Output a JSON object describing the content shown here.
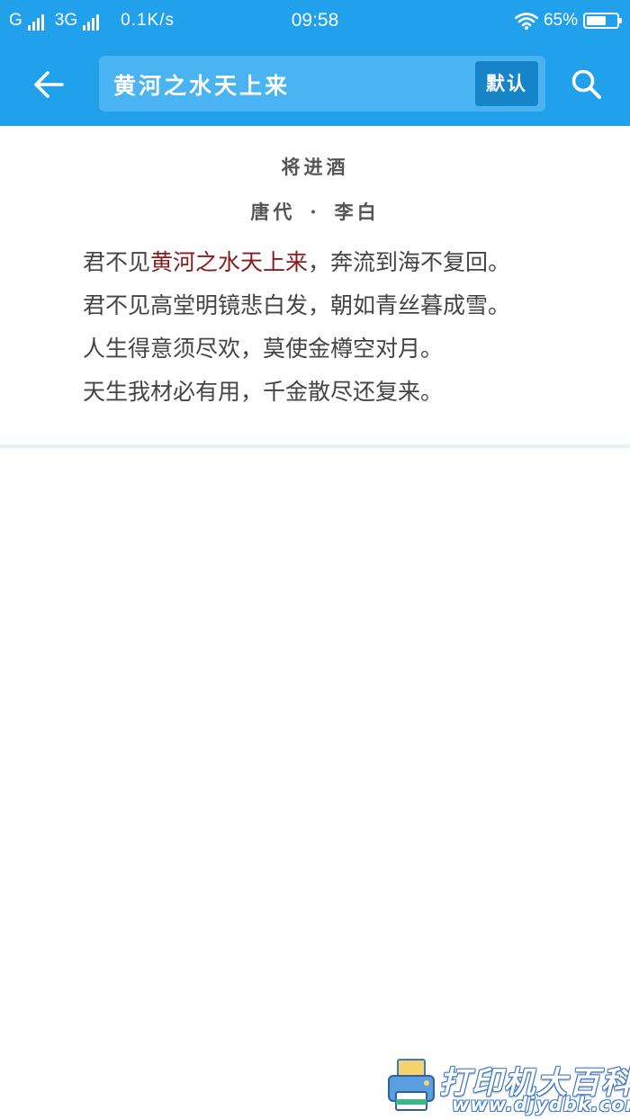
{
  "status_bar": {
    "carrier1": "G",
    "carrier2": "3G",
    "net_speed": "0.1K/s",
    "time": "09:58",
    "battery_percent": "65%",
    "battery_level": 0.65
  },
  "toolbar": {
    "search_query": "黄河之水天上来",
    "default_label": "默认",
    "back_icon": "arrow-left-icon",
    "search_icon": "search-icon"
  },
  "poem": {
    "title": "将进酒",
    "dynasty": "唐代",
    "separator": "·",
    "author": "李白",
    "lines": [
      {
        "before": "君不见",
        "highlight": "黄河之水天上来",
        "after": "，奔流到海不复回。"
      },
      {
        "before": "君不见高堂明镜悲白发，朝如青丝暮成雪。",
        "highlight": "",
        "after": ""
      },
      {
        "before": "人生得意须尽欢，莫使金樽空对月。",
        "highlight": "",
        "after": ""
      },
      {
        "before": "天生我材必有用，千金散尽还复来。",
        "highlight": "",
        "after": ""
      }
    ]
  },
  "watermark": {
    "name": "打印机大百科",
    "url": "www.djydbk.com"
  },
  "colors": {
    "primary": "#21a0ec",
    "search_box": "#4ab3f1",
    "button": "#1684c9",
    "highlight": "#8b1a1a",
    "text": "#444444"
  }
}
